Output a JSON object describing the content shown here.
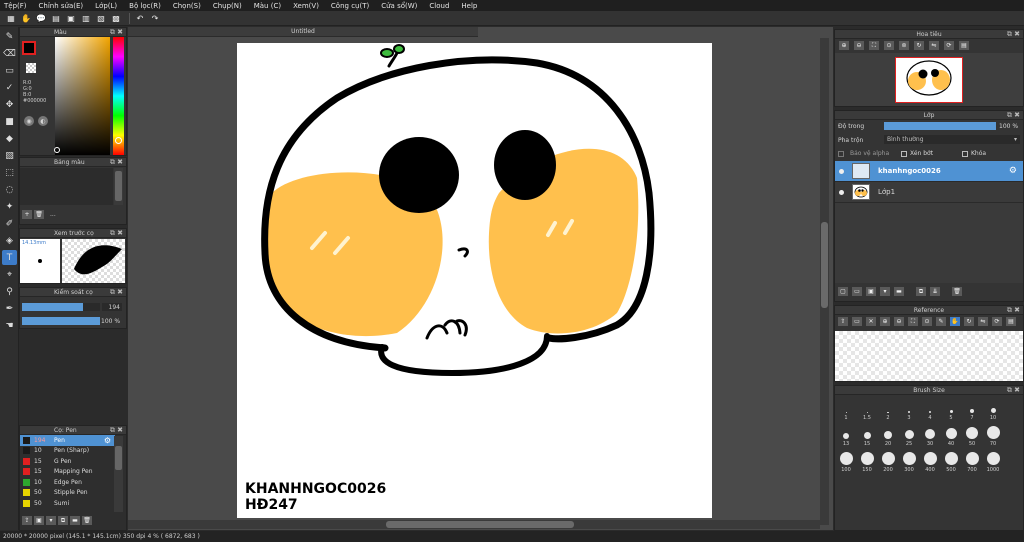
{
  "menu": [
    "Tệp(F)",
    "Chỉnh sửa(E)",
    "Lớp(L)",
    "Bộ lọc(R)",
    "Chọn(S)",
    "Chụp(N)",
    "Màu (C)",
    "Xem(V)",
    "Công cụ(T)",
    "Cửa sổ(W)",
    "Cloud",
    "Help"
  ],
  "document": {
    "tab_title": "Untitled"
  },
  "color_panel": {
    "title": "Màu",
    "rgb": [
      "R:0",
      "G:0",
      "B:0"
    ],
    "hex": "#000000",
    "fg_color": "#000000",
    "accent": "#e02020"
  },
  "palette_panel": {
    "title": "Bảng màu",
    "more": "..."
  },
  "brush_preview_panel": {
    "title": "Xem trước cọ",
    "size": "14.13mm"
  },
  "brush_control_panel": {
    "title": "Kiểm soát cọ",
    "size_value": "194",
    "opacity_value": "100 %",
    "size_fraction": 0.78,
    "opacity_fraction": 1.0
  },
  "brush_list_panel": {
    "title": "Cọ: Pen",
    "items": [
      {
        "size": "194",
        "name": "Pen",
        "color": "#1a1a1a",
        "selected": true
      },
      {
        "size": "10",
        "name": "Pen (Sharp)",
        "color": "#1a1a1a",
        "selected": false
      },
      {
        "size": "15",
        "name": "G Pen",
        "color": "#e02020",
        "selected": false
      },
      {
        "size": "15",
        "name": "Mapping Pen",
        "color": "#e02020",
        "selected": false
      },
      {
        "size": "10",
        "name": "Edge Pen",
        "color": "#2ea82e",
        "selected": false
      },
      {
        "size": "50",
        "name": "Stipple Pen",
        "color": "#e6d400",
        "selected": false
      },
      {
        "size": "50",
        "name": "Sumi",
        "color": "#e6d400",
        "selected": false
      }
    ]
  },
  "navigator_panel": {
    "title": "Hoa tiêu"
  },
  "layer_panel": {
    "title": "Lớp",
    "opacity_label": "Độ trong",
    "opacity_value": "100 %",
    "opacity_fraction": 1.0,
    "blend_label": "Pha trộn",
    "blend_value": "Bình thường",
    "protect_alpha": "Bảo vệ alpha",
    "clipping": "Xén bớt",
    "lock": "Khóa",
    "layers": [
      {
        "name": "khanhngoc0026",
        "selected": true
      },
      {
        "name": "Lớp1",
        "selected": false
      }
    ]
  },
  "reference_panel": {
    "title": "Reference"
  },
  "brush_size_panel": {
    "title": "Brush Size",
    "sizes": [
      "1",
      "1.5",
      "2",
      "3",
      "4",
      "5",
      "7",
      "10",
      "13",
      "15",
      "20",
      "25",
      "30",
      "40",
      "50",
      "70",
      "100",
      "150",
      "200",
      "300",
      "400",
      "500",
      "700",
      "1000"
    ]
  },
  "artwork": {
    "signature_line1": "KHANHNGOC0026",
    "signature_line2": "HĐ247",
    "cheek_color": "#ffc04d",
    "outline_color": "#000000"
  },
  "status": "20000 * 20000 pixel  (145.1 * 145.1cm)  350 dpi  4 %  ( 6872, 683 )"
}
